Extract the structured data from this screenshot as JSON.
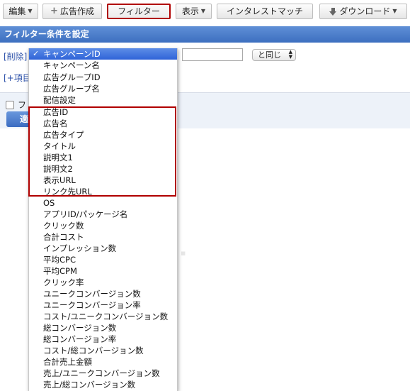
{
  "toolbar": {
    "edit_label": "編集",
    "create_ad_label": "広告作成",
    "filter_label": "フィルター",
    "view_label": "表示",
    "install_match_label": "インタレストマッチ",
    "download_label": "ダウンロード"
  },
  "filter_panel": {
    "title": "フィルター条件を設定",
    "delete_link": "[削除]",
    "add_item_link": "[+項目",
    "operator": "と同じ",
    "checkbox_label": "フ",
    "apply_button": "適"
  },
  "dropdown": {
    "selected": "キャンペーンID",
    "options": [
      "キャンペーンID",
      "キャンペーン名",
      "広告グループID",
      "広告グループ名",
      "配信設定",
      "広告ID",
      "広告名",
      "広告タイプ",
      "タイトル",
      "説明文1",
      "説明文2",
      "表示URL",
      "リンク先URL",
      "OS",
      "アプリID/パッケージ名",
      "クリック数",
      "合計コスト",
      "インプレッション数",
      "平均CPC",
      "平均CPM",
      "クリック率",
      "ユニークコンバージョン数",
      "ユニークコンバージョン率",
      "コスト/ユニークコンバージョン数",
      "総コンバージョン数",
      "総コンバージョン率",
      "コスト/総コンバージョン数",
      "合計売上金額",
      "売上/ユニークコンバージョン数",
      "売上/総コンバージョン数"
    ]
  },
  "colors": {
    "header_blue": "#3d6fc0",
    "highlight_red": "#b00000",
    "selected_blue": "#2f63d8"
  }
}
